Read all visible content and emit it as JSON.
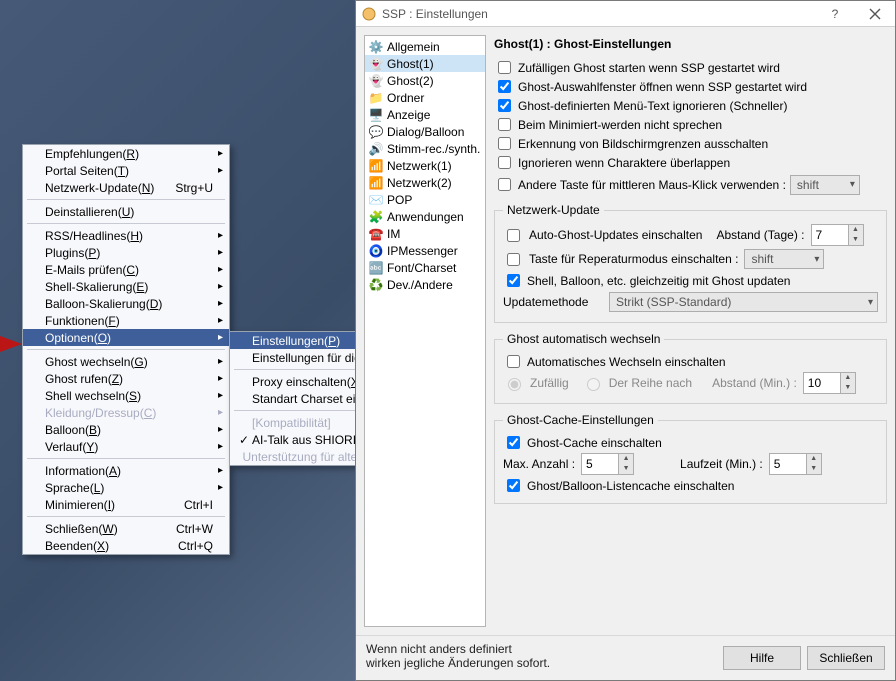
{
  "menu1": {
    "items": [
      {
        "label": "Empfehlungen(R)",
        "u": "R",
        "arrow": true
      },
      {
        "label": "Portal Seiten(T)",
        "u": "T",
        "arrow": true
      },
      {
        "label": "Netzwerk-Update(N)",
        "u": "N",
        "accel": "Strg+U"
      },
      "sep",
      {
        "label": "Deinstallieren(U)",
        "u": "U"
      },
      "sep",
      {
        "label": "RSS/Headlines(H)",
        "u": "H",
        "arrow": true
      },
      {
        "label": "Plugins(P)",
        "u": "P",
        "arrow": true
      },
      {
        "label": "E-Mails prüfen(C)",
        "u": "C",
        "arrow": true
      },
      {
        "label": "Shell-Skalierung(E)",
        "u": "E",
        "arrow": true
      },
      {
        "label": "Balloon-Skalierung(D)",
        "u": "D",
        "arrow": true
      },
      {
        "label": "Funktionen(F)",
        "u": "F",
        "arrow": true
      },
      {
        "label": "Optionen(O)",
        "u": "O",
        "arrow": true,
        "hl": true
      },
      "sep",
      {
        "label": "Ghost wechseln(G)",
        "u": "G",
        "arrow": true
      },
      {
        "label": "Ghost rufen(Z)",
        "u": "Z",
        "arrow": true
      },
      {
        "label": "Shell wechseln(S)",
        "u": "S",
        "arrow": true
      },
      {
        "label": "Kleidung/Dressup(C)",
        "u": "C",
        "arrow": true,
        "disabled": true
      },
      {
        "label": "Balloon(B)",
        "u": "B",
        "arrow": true
      },
      {
        "label": "Verlauf(Y)",
        "u": "Y",
        "arrow": true
      },
      "sep",
      {
        "label": "Information(A)",
        "u": "A",
        "arrow": true
      },
      {
        "label": "Sprache(L)",
        "u": "L",
        "arrow": true
      },
      {
        "label": "Minimieren(I)",
        "u": "I",
        "accel": "Ctrl+I"
      },
      "sep",
      {
        "label": "Schließen(W)",
        "u": "W",
        "accel": "Ctrl+W"
      },
      {
        "label": "Beenden(X)",
        "u": "X",
        "accel": "Ctrl+Q"
      }
    ]
  },
  "menu2": {
    "items": [
      {
        "label": "Einstellungen(P)",
        "u": "P",
        "hl": true
      },
      {
        "label": "Einstellungen für diesen Ghost(G)",
        "u": "G"
      },
      "sep",
      {
        "label": "Proxy einschalten(X)",
        "u": "X"
      },
      {
        "label": "Standart Charset einstellen(C)",
        "u": "C"
      },
      "sep",
      {
        "label": "[Kompatibilität]",
        "disabled": true
      },
      {
        "label": "AI-Talk aus SHIORI verwenden(S)",
        "u": "S",
        "checked": true
      },
      {
        "label": "Unterstützung für alte Spezifikation(O)",
        "u": "O",
        "disabled": true
      }
    ]
  },
  "dialog": {
    "title": "SSP : Einstellungen",
    "tree": [
      {
        "label": "Allgemein",
        "icon": "⚙️"
      },
      {
        "label": "Ghost(1)",
        "icon": "👻",
        "sel": true
      },
      {
        "label": "Ghost(2)",
        "icon": "👻"
      },
      {
        "label": "Ordner",
        "icon": "📁"
      },
      {
        "label": "Anzeige",
        "icon": "🖥️"
      },
      {
        "label": "Dialog/Balloon",
        "icon": "💬"
      },
      {
        "label": "Stimm-rec./synth.",
        "icon": "🔊"
      },
      {
        "label": "Netzwerk(1)",
        "icon": "📶"
      },
      {
        "label": "Netzwerk(2)",
        "icon": "📶"
      },
      {
        "label": "POP",
        "icon": "✉️"
      },
      {
        "label": "Anwendungen",
        "icon": "🧩"
      },
      {
        "label": "IM",
        "icon": "☎️"
      },
      {
        "label": "IPMessenger",
        "icon": "🧿"
      },
      {
        "label": "Font/Charset",
        "icon": "🔤"
      },
      {
        "label": "Dev./Andere",
        "icon": "♻️"
      }
    ],
    "pane": {
      "title": "Ghost(1) : Ghost-Einstellungen",
      "checks": [
        {
          "label": "Zufälligen Ghost starten wenn SSP gestartet wird",
          "checked": false
        },
        {
          "label": "Ghost-Auswahlfenster öffnen wenn SSP gestartet wird",
          "checked": true
        },
        {
          "label": "Ghost-definierten Menü-Text ignorieren (Schneller)",
          "checked": true
        },
        {
          "label": "Beim Minimiert-werden nicht sprechen",
          "checked": false
        },
        {
          "label": "Erkennung von Bildschirmgrenzen ausschalten",
          "checked": false
        },
        {
          "label": "Ignorieren wenn Charaktere überlappen",
          "checked": false
        }
      ],
      "mouseLabel": "Andere Taste für mittleren Maus-Klick verwenden :",
      "mouseValue": "shift",
      "net": {
        "title": "Netzwerk-Update",
        "auto": {
          "label": "Auto-Ghost-Updates einschalten",
          "checked": false
        },
        "abstand": {
          "label": "Abstand (Tage) :",
          "value": "7"
        },
        "repair": {
          "label": "Taste für Reperaturmodus einschalten :",
          "checked": false,
          "value": "shift"
        },
        "shell": {
          "label": "Shell, Balloon, etc. gleichzeitig mit Ghost updaten",
          "checked": true
        },
        "method": {
          "label": "Updatemethode",
          "value": "Strikt (SSP-Standard)"
        }
      },
      "auto": {
        "title": "Ghost automatisch wechseln",
        "enable": {
          "label": "Automatisches Wechseln einschalten",
          "checked": false
        },
        "radio1": "Zufällig",
        "radio2": "Der Reihe nach",
        "abstand": {
          "label": "Abstand (Min.) :",
          "value": "10"
        }
      },
      "cache": {
        "title": "Ghost-Cache-Einstellungen",
        "enable": {
          "label": "Ghost-Cache einschalten",
          "checked": true
        },
        "max": {
          "label": "Max. Anzahl :",
          "value": "5"
        },
        "time": {
          "label": "Laufzeit (Min.) :",
          "value": "5"
        },
        "list": {
          "label": "Ghost/Balloon-Listencache einschalten",
          "checked": true
        }
      }
    },
    "footer": {
      "text1": "Wenn nicht anders definiert",
      "text2": "wirken jegliche Änderungen sofort.",
      "help": "Hilfe",
      "close": "Schließen"
    }
  }
}
